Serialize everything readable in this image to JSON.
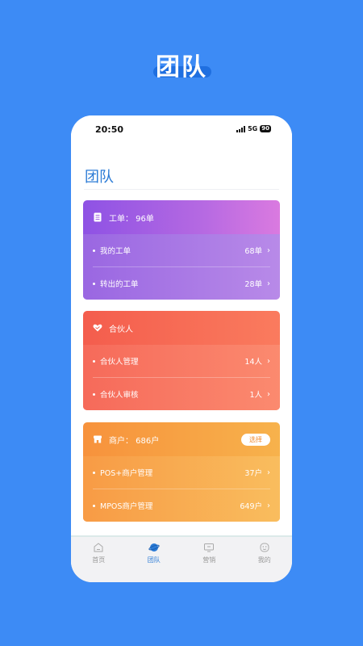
{
  "banner": {
    "title": "团队"
  },
  "status_bar": {
    "time": "20:50",
    "network": "5G",
    "battery": "90"
  },
  "page": {
    "title": "团队"
  },
  "cards": {
    "work_orders": {
      "header": "工单： 96单",
      "icon": "document-list-icon",
      "rows": [
        {
          "label": "我的工单",
          "value": "68单"
        },
        {
          "label": "转出的工单",
          "value": "28单"
        }
      ]
    },
    "partners": {
      "header": "合伙人",
      "icon": "handshake-icon",
      "rows": [
        {
          "label": "合伙人管理",
          "value": "14人"
        },
        {
          "label": "合伙人审核",
          "value": "1人"
        }
      ]
    },
    "merchants": {
      "header": "商户： 686户",
      "icon": "store-icon",
      "switch_label": "选择",
      "rows": [
        {
          "label": "POS+商户管理",
          "value": "37户"
        },
        {
          "label": "MPOS商户管理",
          "value": "649户"
        }
      ]
    }
  },
  "tabbar": {
    "items": [
      {
        "label": "首页",
        "icon": "home-icon"
      },
      {
        "label": "团队",
        "icon": "planet-icon",
        "active": true
      },
      {
        "label": "营销",
        "icon": "monitor-icon"
      },
      {
        "label": "我的",
        "icon": "profile-icon"
      }
    ]
  },
  "colors": {
    "background": "#3d8bf5",
    "accent": "#2b7bd6",
    "card_purple": "#8e52e4",
    "card_red": "#f45d4d",
    "card_orange": "#f7923c"
  }
}
